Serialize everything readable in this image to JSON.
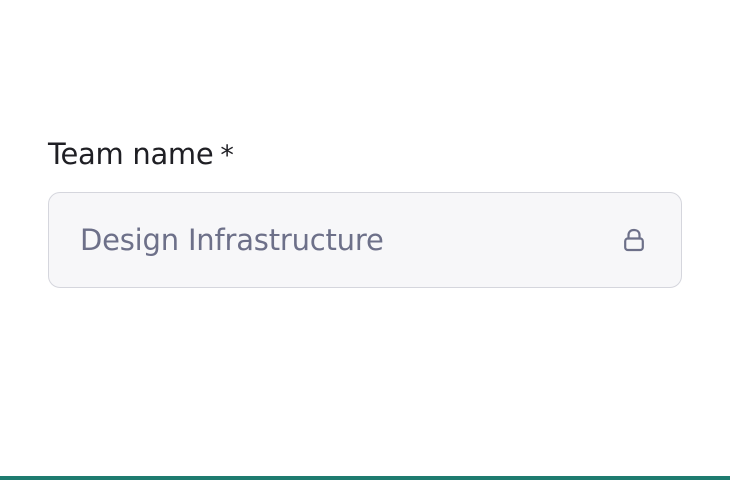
{
  "team_name_field": {
    "label": "Team name",
    "required_mark": "*",
    "value": "Design Infrastructure",
    "locked": true,
    "icon": "lock-icon"
  },
  "colors": {
    "accent": "#1e7b6f",
    "label_text": "#1f1f24",
    "value_text": "#6d7089",
    "input_background": "#f7f7f9",
    "input_border": "#d5d6dd"
  }
}
